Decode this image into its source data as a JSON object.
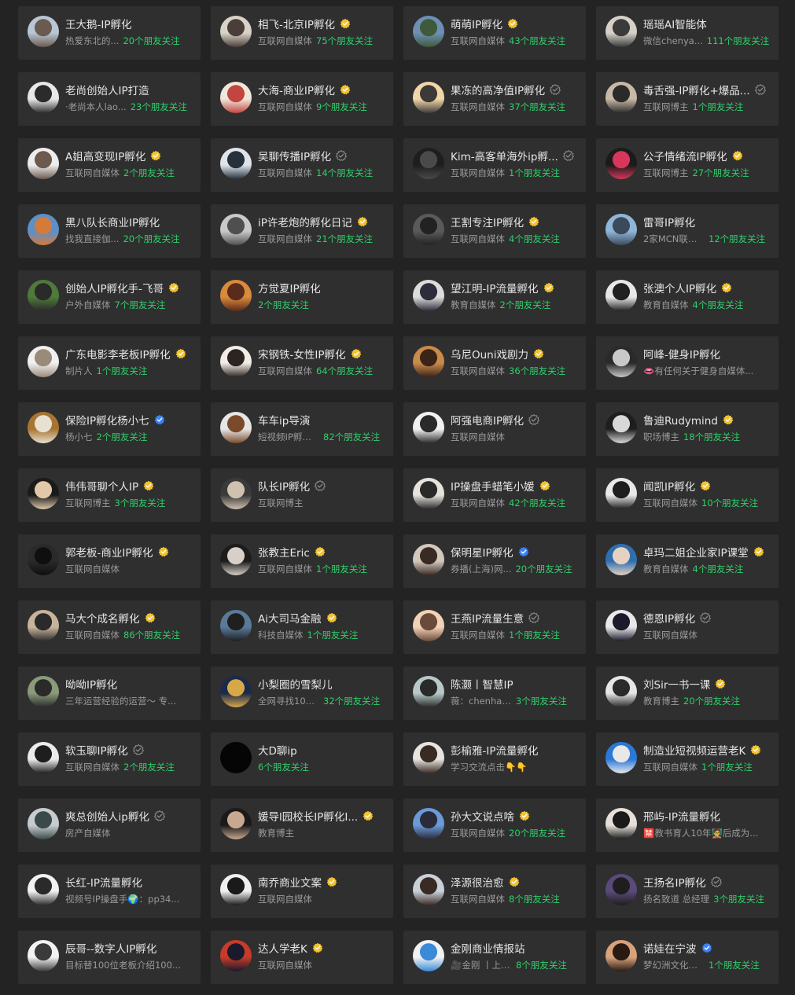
{
  "colors": {
    "background": "#232323",
    "card": "#2f2f2f",
    "name": "#e6e6e6",
    "desc": "#9a9a9a",
    "follow": "#2ed06a",
    "badge_gold": "#f2c230",
    "badge_blue": "#3b82f6",
    "badge_gray": "#8a8a8a"
  },
  "accounts": [
    {
      "name": "王大鹅-IP孵化",
      "badge": "none",
      "desc": "热爱东北的...",
      "follow": "20个朋友关注",
      "avatar_colors": [
        "#b9c6d6",
        "#6b5a4f"
      ]
    },
    {
      "name": "相飞-北京IP孵化",
      "badge": "gold",
      "desc": "互联网自媒体",
      "follow": "75个朋友关注",
      "avatar_colors": [
        "#d8d2c8",
        "#4a3f38"
      ]
    },
    {
      "name": "萌萌IP孵化",
      "badge": "gold",
      "desc": "互联网自媒体",
      "follow": "43个朋友关注",
      "avatar_colors": [
        "#6d8fb3",
        "#3e5a3a"
      ]
    },
    {
      "name": "瑶瑶AI智能体",
      "badge": "none",
      "desc": "微信chenya...",
      "follow": "111个朋友关注",
      "avatar_colors": [
        "#d6d0c8",
        "#3a3a3a"
      ]
    },
    {
      "name": "老尚创始人IP打造",
      "badge": "none",
      "desc": "·老尚本人lao...",
      "follow": "23个朋友关注",
      "avatar_colors": [
        "#e8e8e8",
        "#2b2b2b"
      ]
    },
    {
      "name": "大海-商业IP孵化",
      "badge": "gold",
      "desc": "互联网自媒体",
      "follow": "9个朋友关注",
      "avatar_colors": [
        "#f0e6dc",
        "#c2453f"
      ]
    },
    {
      "name": "果冻的高净值IP孵化",
      "badge": "gray",
      "desc": "互联网自媒体",
      "follow": "37个朋友关注",
      "avatar_colors": [
        "#f2d6a8",
        "#3c3a38"
      ]
    },
    {
      "name": "毒舌强-IP孵化+爆品...",
      "badge": "gray",
      "desc": "互联网博主",
      "follow": "1个朋友关注",
      "avatar_colors": [
        "#c8b8a6",
        "#2a2a2a"
      ]
    },
    {
      "name": "A姐高变现IP孵化",
      "badge": "gold",
      "desc": "互联网自媒体",
      "follow": "2个朋友关注",
      "avatar_colors": [
        "#ededed",
        "#6c5a4e"
      ]
    },
    {
      "name": "吴聊传播IP孵化",
      "badge": "gray",
      "desc": "互联网自媒体",
      "follow": "14个朋友关注",
      "avatar_colors": [
        "#dfe4ea",
        "#25303b"
      ]
    },
    {
      "name": "Kim-高客单海外ip孵...",
      "badge": "gray",
      "desc": "互联网自媒体",
      "follow": "1个朋友关注",
      "avatar_colors": [
        "#1e1e1e",
        "#4a4a4a"
      ]
    },
    {
      "name": "公子情绪流IP孵化",
      "badge": "gold",
      "desc": "互联网博主",
      "follow": "27个朋友关注",
      "avatar_colors": [
        "#1b1b1b",
        "#d8365a"
      ]
    },
    {
      "name": "黑八队长商业IP孵化",
      "badge": "none",
      "desc": "找我直接伽...",
      "follow": "20个朋友关注",
      "avatar_colors": [
        "#5d8fc9",
        "#d47a3a"
      ]
    },
    {
      "name": "iP许老炮的孵化日记",
      "badge": "gold",
      "desc": "互联网自媒体",
      "follow": "21个朋友关注",
      "avatar_colors": [
        "#c9c9c9",
        "#4f4f4f"
      ]
    },
    {
      "name": "王割专注IP孵化",
      "badge": "gold",
      "desc": "互联网自媒体",
      "follow": "4个朋友关注",
      "avatar_colors": [
        "#5a5a5a",
        "#222222"
      ]
    },
    {
      "name": "雷哥IP孵化",
      "badge": "none",
      "desc": "2家MCN联合...",
      "follow": "12个朋友关注",
      "avatar_colors": [
        "#8fb6d8",
        "#3a4a5a"
      ]
    },
    {
      "name": "创始人IP孵化手-飞哥",
      "badge": "gold",
      "desc": "户外自媒体",
      "follow": "7个朋友关注",
      "avatar_colors": [
        "#4f7a3a",
        "#2a2a2a"
      ]
    },
    {
      "name": "方觉夏IP孵化",
      "badge": "none",
      "desc": "",
      "follow": "2个朋友关注",
      "avatar_colors": [
        "#d98a3a",
        "#5a2a1a"
      ]
    },
    {
      "name": "望江明-IP流量孵化",
      "badge": "gold",
      "desc": "教育自媒体",
      "follow": "2个朋友关注",
      "avatar_colors": [
        "#dcdcdc",
        "#2c2c3a"
      ]
    },
    {
      "name": "张澳个人IP孵化",
      "badge": "gold",
      "desc": "教育自媒体",
      "follow": "4个朋友关注",
      "avatar_colors": [
        "#e8e8e8",
        "#202020"
      ]
    },
    {
      "name": "广东电影李老板IP孵化",
      "badge": "gold",
      "desc": "制片人",
      "follow": "1个朋友关注",
      "avatar_colors": [
        "#f0f0f0",
        "#9a8a7a"
      ]
    },
    {
      "name": "宋钢铁-女性IP孵化",
      "badge": "gold",
      "desc": "互联网自媒体",
      "follow": "64个朋友关注",
      "avatar_colors": [
        "#f2ede6",
        "#2c2420"
      ]
    },
    {
      "name": "乌尼Ouni戏剧力",
      "badge": "gold",
      "desc": "互联网自媒体",
      "follow": "36个朋友关注",
      "avatar_colors": [
        "#c98a4a",
        "#3a2418"
      ]
    },
    {
      "name": "阿峰-健身IP孵化",
      "badge": "none",
      "desc": "👄有任何关于健身自媒体...",
      "follow": "",
      "avatar_colors": [
        "#2a2a2a",
        "#c9c9c9"
      ]
    },
    {
      "name": "保险IP孵化杨小七",
      "badge": "blue",
      "desc": "杨小七",
      "follow": "2个朋友关注",
      "avatar_colors": [
        "#a8742f",
        "#e8e0d2"
      ]
    },
    {
      "name": "车车ip导演",
      "badge": "none",
      "desc": "短视频IP孵化...",
      "follow": "82个朋友关注",
      "avatar_colors": [
        "#e6e6e6",
        "#7a4a2a"
      ]
    },
    {
      "name": "阿强电商IP孵化",
      "badge": "gray",
      "desc": "互联网自媒体",
      "follow": "",
      "avatar_colors": [
        "#f2f2f2",
        "#2a2a2a"
      ]
    },
    {
      "name": "鲁迪Rudymind",
      "badge": "gold",
      "desc": "职场博主",
      "follow": "18个朋友关注",
      "avatar_colors": [
        "#1e1e1e",
        "#d8d8d8"
      ]
    },
    {
      "name": "伟伟哥聊个人IP",
      "badge": "gold",
      "desc": "互联网博主",
      "follow": "3个朋友关注",
      "avatar_colors": [
        "#1a1a1a",
        "#e0c8a8"
      ]
    },
    {
      "name": "队长IP孵化",
      "badge": "gray",
      "desc": "互联网博主",
      "follow": "",
      "avatar_colors": [
        "#3a3a3a",
        "#d0c0b0"
      ]
    },
    {
      "name": "IP操盘手蜡笔小媛",
      "badge": "gold",
      "desc": "互联网自媒体",
      "follow": "42个朋友关注",
      "avatar_colors": [
        "#e6e2dc",
        "#2a2a2a"
      ]
    },
    {
      "name": "闻凯IP孵化",
      "badge": "gold",
      "desc": "互联网自媒体",
      "follow": "10个朋友关注",
      "avatar_colors": [
        "#e8e8e8",
        "#1e1e1e"
      ]
    },
    {
      "name": "郭老板-商业IP孵化",
      "badge": "gold",
      "desc": "互联网自媒体",
      "follow": "",
      "avatar_colors": [
        "#2a2a2a",
        "#0f0f0f"
      ]
    },
    {
      "name": "张教主Eric",
      "badge": "gold",
      "desc": "互联网自媒体",
      "follow": "1个朋友关注",
      "avatar_colors": [
        "#1c1c1c",
        "#d8d0c8"
      ]
    },
    {
      "name": "保明星IP孵化",
      "badge": "blue",
      "desc": "券播(上海)网...",
      "follow": "20个朋友关注",
      "avatar_colors": [
        "#d2c8be",
        "#3a2a24"
      ]
    },
    {
      "name": "卓玛二姐企业家IP课堂",
      "badge": "gold",
      "desc": "教育自媒体",
      "follow": "4个朋友关注",
      "avatar_colors": [
        "#2f6fb0",
        "#e6d2c2"
      ]
    },
    {
      "name": "马大个成名孵化",
      "badge": "gold",
      "desc": "互联网自媒体",
      "follow": "86个朋友关注",
      "avatar_colors": [
        "#c8b49a",
        "#2a2a2a"
      ]
    },
    {
      "name": "Ai大司马金融",
      "badge": "gold",
      "desc": "科技自媒体",
      "follow": "1个朋友关注",
      "avatar_colors": [
        "#5a7a9a",
        "#1f1f1f"
      ]
    },
    {
      "name": "王燕IP流量生意",
      "badge": "gray",
      "desc": "互联网自媒体",
      "follow": "1个朋友关注",
      "avatar_colors": [
        "#f2d2b8",
        "#6a4a3a"
      ]
    },
    {
      "name": "德恩IP孵化",
      "badge": "gray",
      "desc": "互联网自媒体",
      "follow": "",
      "avatar_colors": [
        "#e8e8ea",
        "#1a1a2a"
      ]
    },
    {
      "name": "呦呦IP孵化",
      "badge": "none",
      "desc": "三年运营经验的运营～ 专...",
      "follow": "",
      "avatar_colors": [
        "#8a9a7a",
        "#2a2a2a"
      ]
    },
    {
      "name": "小梨圈的雪梨儿",
      "badge": "none",
      "desc": "全网寻找100...",
      "follow": "32个朋友关注",
      "avatar_colors": [
        "#1a2a4a",
        "#d8a848"
      ]
    },
    {
      "name": "陈灏丨智慧IP",
      "badge": "none",
      "desc": "薇：chenhaos...",
      "follow": "3个朋友关注",
      "avatar_colors": [
        "#b8c8c8",
        "#2a2a2a"
      ]
    },
    {
      "name": "刘Sir一书一课",
      "badge": "gold",
      "desc": "教育博主",
      "follow": "20个朋友关注",
      "avatar_colors": [
        "#e6e6e6",
        "#2a2a2a"
      ]
    },
    {
      "name": "软玉聊IP孵化",
      "badge": "gray",
      "desc": "互联网自媒体",
      "follow": "2个朋友关注",
      "avatar_colors": [
        "#ececec",
        "#1e1e1e"
      ]
    },
    {
      "name": "大D聊ip",
      "badge": "none",
      "desc": "",
      "follow": "6个朋友关注",
      "avatar_colors": [
        "#050505",
        "#050505"
      ]
    },
    {
      "name": "彭榆雅-IP流量孵化",
      "badge": "none",
      "desc": "学习交流点击👇👇",
      "follow": "",
      "avatar_colors": [
        "#e8e4e0",
        "#3a2a24"
      ]
    },
    {
      "name": "制造业短视频运营老K",
      "badge": "gold",
      "desc": "互联网自媒体",
      "follow": "1个朋友关注",
      "avatar_colors": [
        "#2a78d8",
        "#e8e8e8"
      ]
    },
    {
      "name": "爽总创始人ip孵化",
      "badge": "gray",
      "desc": "房产自媒体",
      "follow": "",
      "avatar_colors": [
        "#c8ccd0",
        "#3a4a4a"
      ]
    },
    {
      "name": "媛导l园校长IP孵化I...",
      "badge": "gold",
      "desc": "教育博主",
      "follow": "",
      "avatar_colors": [
        "#1a1a1a",
        "#c8a890"
      ]
    },
    {
      "name": "孙大文说点啥",
      "badge": "gold",
      "desc": "互联网自媒体",
      "follow": "20个朋友关注",
      "avatar_colors": [
        "#6a9ad8",
        "#2a2a3a"
      ]
    },
    {
      "name": "邢屿-IP流量孵化",
      "badge": "none",
      "desc": "🈲教书育人10年🧑‍🏫后成为...",
      "follow": "",
      "avatar_colors": [
        "#e8e0d8",
        "#1a1a1a"
      ]
    },
    {
      "name": "长红-IP流量孵化",
      "badge": "none",
      "desc": "视频号IP操盘手🌍：pp34...",
      "follow": "",
      "avatar_colors": [
        "#f2f2f2",
        "#2a2a2a"
      ]
    },
    {
      "name": "南乔商业文案",
      "badge": "gold",
      "desc": "互联网自媒体",
      "follow": "",
      "avatar_colors": [
        "#f0f0f0",
        "#1a1a1a"
      ]
    },
    {
      "name": "泽源很治愈",
      "badge": "gold",
      "desc": "互联网自媒体",
      "follow": "8个朋友关注",
      "avatar_colors": [
        "#c8d0d8",
        "#3a2a24"
      ]
    },
    {
      "name": "王扬名IP孵化",
      "badge": "gray",
      "desc": "扬名致道 总经理",
      "follow": "3个朋友关注",
      "avatar_colors": [
        "#5a4a7a",
        "#1e1e1e"
      ]
    },
    {
      "name": "辰哥--数字人IP孵化",
      "badge": "none",
      "desc": "目标替100位老板介绍100...",
      "follow": "",
      "avatar_colors": [
        "#f2f2f2",
        "#3a3a3a"
      ]
    },
    {
      "name": "达人学老K",
      "badge": "gold",
      "desc": "互联网自媒体",
      "follow": "",
      "avatar_colors": [
        "#c83a2a",
        "#1a1a2a"
      ]
    },
    {
      "name": "金刚商业情报站",
      "badge": "none",
      "desc": "🎥金刚 丨上市...",
      "follow": "8个朋友关注",
      "avatar_colors": [
        "#f2f2f2",
        "#3a8ad8"
      ]
    },
    {
      "name": "诺娃在宁波",
      "badge": "blue",
      "desc": "梦幻洲文化传...",
      "follow": "1个朋友关注",
      "avatar_colors": [
        "#d8a27a",
        "#2a1a14"
      ]
    }
  ]
}
